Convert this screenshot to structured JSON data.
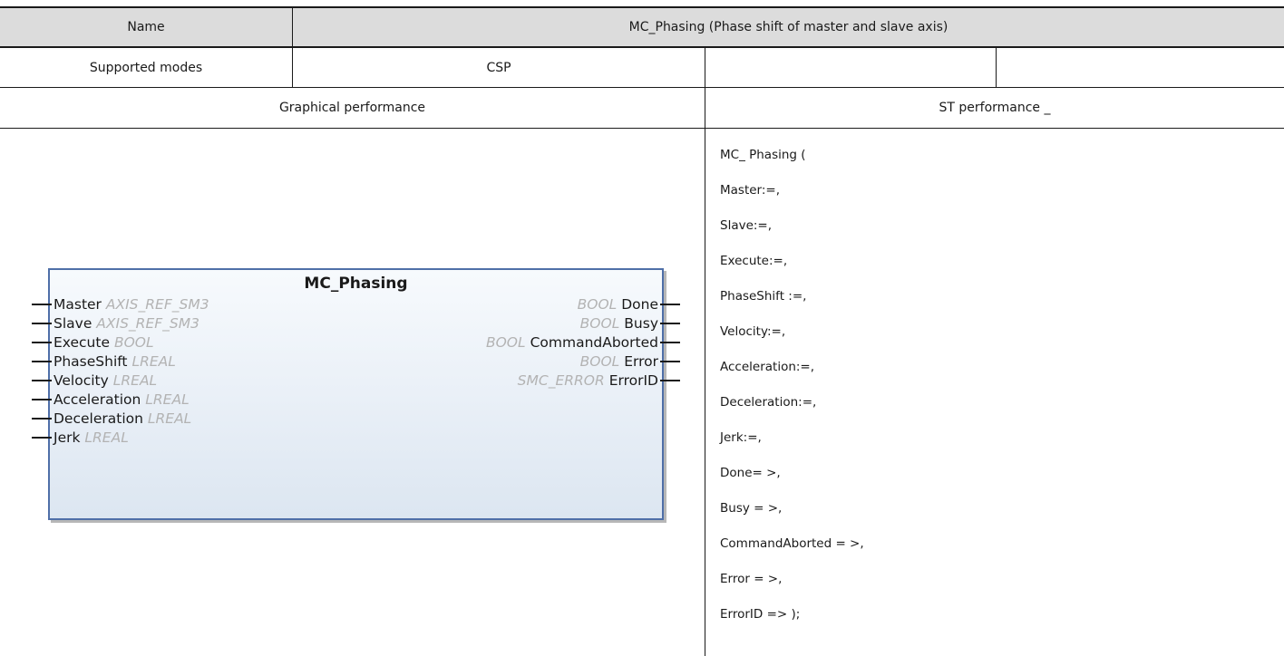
{
  "table": {
    "header": {
      "name_label": "Name",
      "name_value": "MC_Phasing (Phase shift of master and slave axis)"
    },
    "modes": {
      "label": "Supported modes",
      "value": "CSP",
      "extra1": "",
      "extra2": ""
    },
    "section_headers": {
      "graphical": "Graphical performance",
      "st": "ST performance _"
    }
  },
  "function_block": {
    "title": "MC_Phasing",
    "inputs": [
      {
        "name": "Master",
        "type": "AXIS_REF_SM3"
      },
      {
        "name": "Slave",
        "type": "AXIS_REF_SM3"
      },
      {
        "name": "Execute",
        "type": "BOOL"
      },
      {
        "name": "PhaseShift",
        "type": "LREAL"
      },
      {
        "name": "Velocity",
        "type": "LREAL"
      },
      {
        "name": "Acceleration",
        "type": "LREAL"
      },
      {
        "name": "Deceleration",
        "type": "LREAL"
      },
      {
        "name": "Jerk",
        "type": "LREAL"
      }
    ],
    "outputs": [
      {
        "name": "Done",
        "type": "BOOL"
      },
      {
        "name": "Busy",
        "type": "BOOL"
      },
      {
        "name": "CommandAborted",
        "type": "BOOL"
      },
      {
        "name": "Error",
        "type": "BOOL"
      },
      {
        "name": "ErrorID",
        "type": "SMC_ERROR"
      }
    ]
  },
  "st_code": [
    "MC_ Phasing (",
    "Master:=,",
    "Slave:=,",
    "Execute:=,",
    "PhaseShift :=,",
    "Velocity:=,",
    "Acceleration:=,",
    "Deceleration:=,",
    "Jerk:=,",
    "Done= >,",
    "Busy = >,",
    "CommandAborted = >,",
    "Error = >,",
    "ErrorID => );"
  ]
}
